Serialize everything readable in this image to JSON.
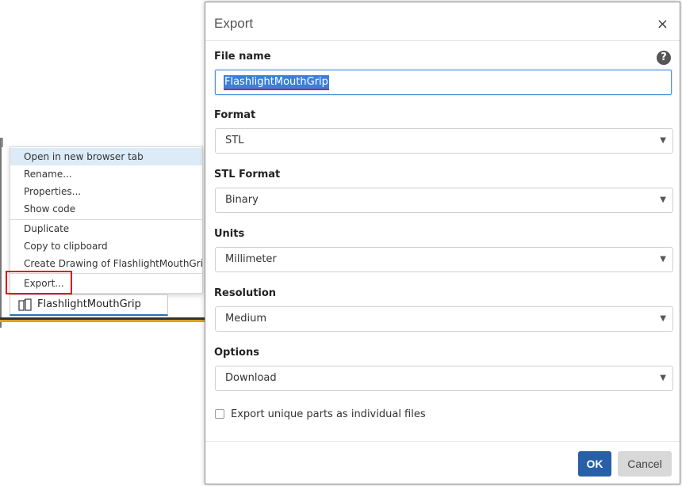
{
  "context_menu": {
    "items": [
      {
        "label": "Open in new browser tab"
      },
      {
        "label": "Rename..."
      },
      {
        "label": "Properties..."
      },
      {
        "label": "Show code"
      },
      {
        "label": "Duplicate"
      },
      {
        "label": "Copy to clipboard"
      },
      {
        "label": "Create Drawing of FlashlightMouthGrip..."
      },
      {
        "label": "Export..."
      }
    ]
  },
  "tab": {
    "label": "FlashlightMouthGrip"
  },
  "dialog": {
    "title": "Export",
    "close_symbol": "×",
    "help_symbol": "?",
    "file_name": {
      "label": "File name",
      "value": "FlashlightMouthGrip"
    },
    "format": {
      "label": "Format",
      "value": "STL"
    },
    "stl_format": {
      "label": "STL Format",
      "value": "Binary"
    },
    "units": {
      "label": "Units",
      "value": "Millimeter"
    },
    "resolution": {
      "label": "Resolution",
      "value": "Medium"
    },
    "options": {
      "label": "Options",
      "value": "Download"
    },
    "checkbox_label": "Export unique parts as individual files",
    "checkbox_checked": false,
    "ok_label": "OK",
    "cancel_label": "Cancel"
  },
  "colors": {
    "primary_button": "#2860a8",
    "highlight_box": "#e01919",
    "menu_hover": "#dcebf7"
  }
}
